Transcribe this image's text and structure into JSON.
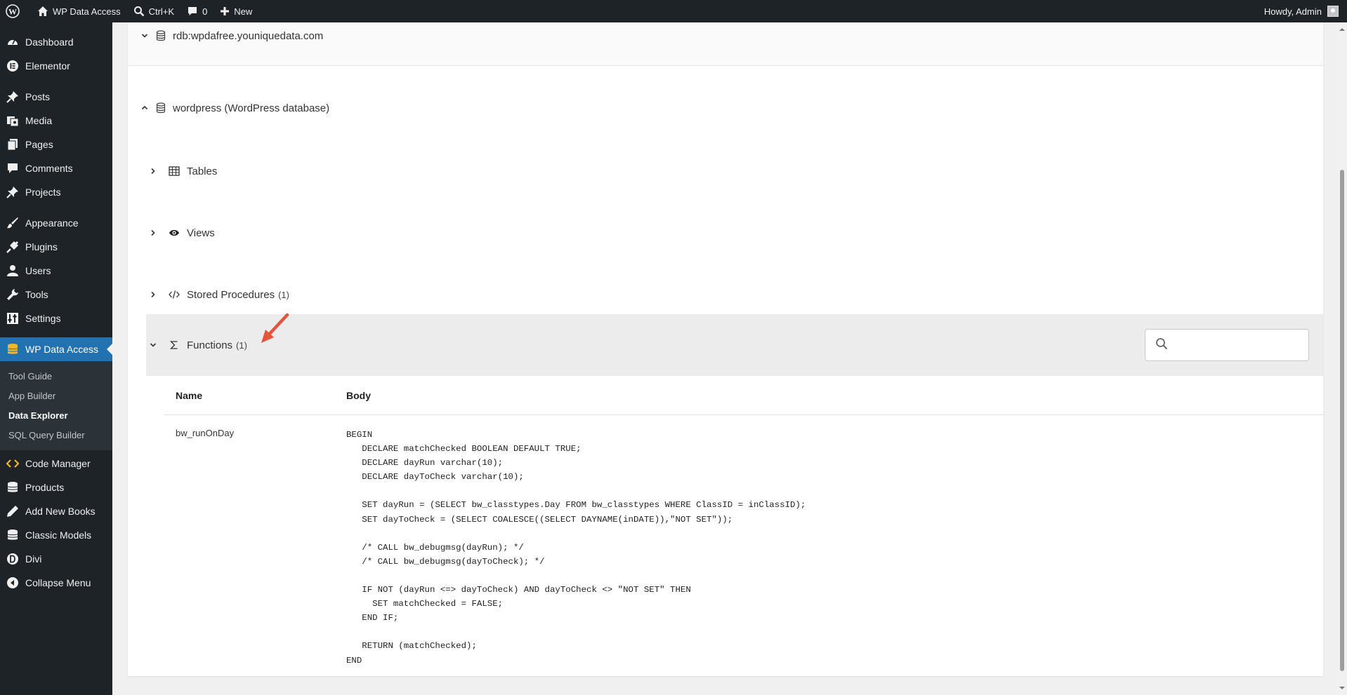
{
  "adminbar": {
    "site_name": "WP Data Access",
    "search_shortcut": "Ctrl+K",
    "comments_count": "0",
    "new_label": "New",
    "greeting": "Howdy, Admin"
  },
  "sidebar": {
    "items": [
      {
        "label": "Dashboard",
        "icon": "dashboard-icon"
      },
      {
        "label": "Elementor",
        "icon": "elementor-icon"
      },
      {
        "label": "Posts",
        "icon": "pin-icon"
      },
      {
        "label": "Media",
        "icon": "media-icon"
      },
      {
        "label": "Pages",
        "icon": "pages-icon"
      },
      {
        "label": "Comments",
        "icon": "comment-icon"
      },
      {
        "label": "Projects",
        "icon": "pin-icon"
      },
      {
        "label": "Appearance",
        "icon": "brush-icon"
      },
      {
        "label": "Plugins",
        "icon": "plugin-icon"
      },
      {
        "label": "Users",
        "icon": "user-icon"
      },
      {
        "label": "Tools",
        "icon": "wrench-icon"
      },
      {
        "label": "Settings",
        "icon": "settings-icon"
      },
      {
        "label": "WP Data Access",
        "icon": "database-icon"
      }
    ],
    "submenu": [
      "Tool Guide",
      "App Builder",
      "Data Explorer",
      "SQL Query Builder"
    ],
    "items_after": [
      {
        "label": "Code Manager",
        "icon": "code-icon"
      },
      {
        "label": "Products",
        "icon": "database-icon"
      },
      {
        "label": "Add New Books",
        "icon": "edit-icon"
      },
      {
        "label": "Classic Models",
        "icon": "database-icon"
      },
      {
        "label": "Divi",
        "icon": "divi-icon"
      },
      {
        "label": "Collapse Menu",
        "icon": "collapse-icon"
      }
    ]
  },
  "explorer": {
    "db_remote": "rdb:wpdafree.youniquedata.com",
    "db_local": "wordpress (WordPress database)",
    "sections": {
      "tables": "Tables",
      "views": "Views",
      "procedures": "Stored Procedures",
      "procedures_count": "(1)",
      "functions": "Functions",
      "functions_count": "(1)"
    },
    "search_placeholder": ""
  },
  "functions_table": {
    "headers": [
      "Name",
      "Body"
    ],
    "rows": [
      {
        "name": "bw_runOnDay",
        "body": "BEGIN\n   DECLARE matchChecked BOOLEAN DEFAULT TRUE;\n   DECLARE dayRun varchar(10);\n   DECLARE dayToCheck varchar(10);\n\n   SET dayRun = (SELECT bw_classtypes.Day FROM bw_classtypes WHERE ClassID = inClassID);\n   SET dayToCheck = (SELECT COALESCE((SELECT DAYNAME(inDATE)),\"NOT SET\"));\n\n   /* CALL bw_debugmsg(dayRun); */\n   /* CALL bw_debugmsg(dayToCheck); */\n\n   IF NOT (dayRun <=> dayToCheck) AND dayToCheck <> \"NOT SET\" THEN\n     SET matchChecked = FALSE;\n   END IF;\n\n   RETURN (matchChecked);\nEND"
      }
    ]
  },
  "colors": {
    "adminbar_bg": "#1d2327",
    "active_menu": "#2271b1",
    "annotation_arrow": "#e5533d"
  }
}
